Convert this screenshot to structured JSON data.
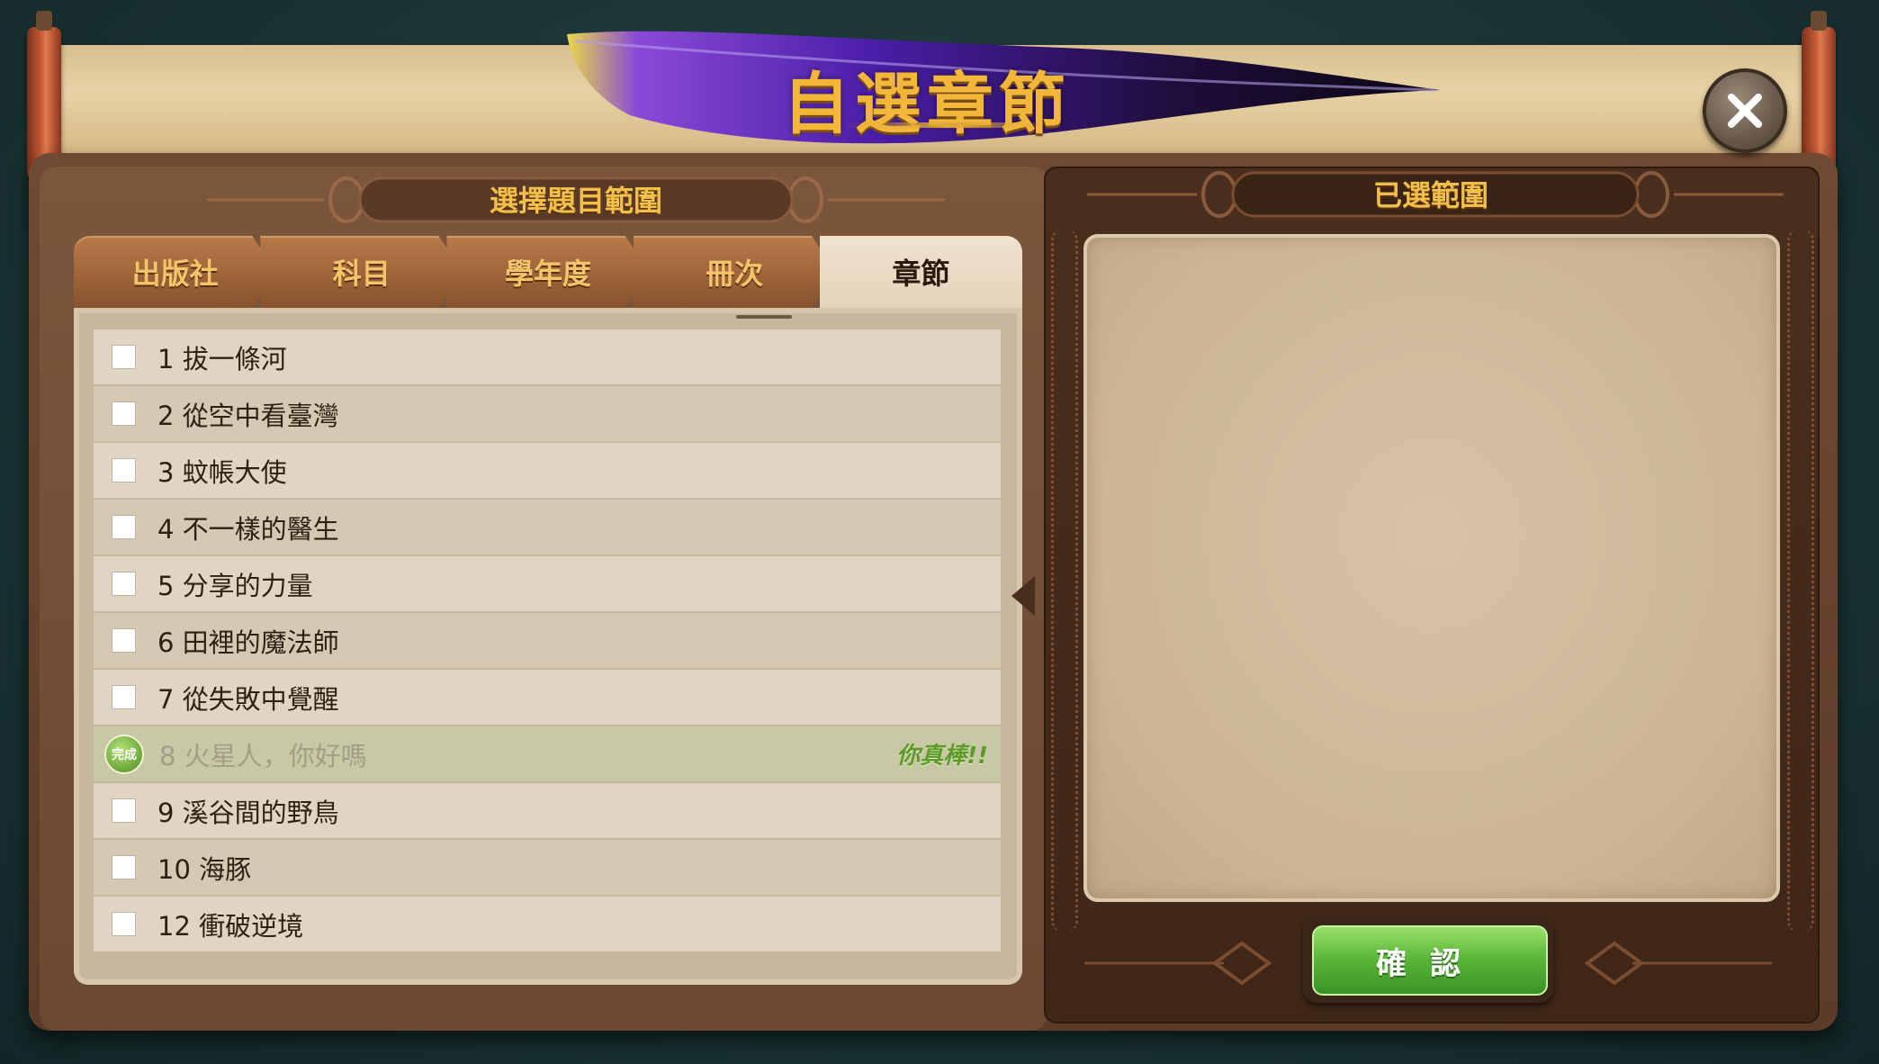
{
  "dialog": {
    "title": "自選章節",
    "close_icon": "close-icon"
  },
  "left_panel": {
    "header": "選擇題目範圍",
    "tabs": [
      {
        "label": "出版社",
        "active": false
      },
      {
        "label": "科目",
        "active": false
      },
      {
        "label": "學年度",
        "active": false
      },
      {
        "label": "冊次",
        "active": false
      },
      {
        "label": "章節",
        "active": true
      }
    ],
    "chapters": [
      {
        "label": "1 拔一條河",
        "completed": false
      },
      {
        "label": "2 從空中看臺灣",
        "completed": false
      },
      {
        "label": "3 蚊帳大使",
        "completed": false
      },
      {
        "label": "4 不一樣的醫生",
        "completed": false
      },
      {
        "label": "5 分享的力量",
        "completed": false
      },
      {
        "label": "6 田裡的魔法師",
        "completed": false
      },
      {
        "label": "7 從失敗中覺醒",
        "completed": false
      },
      {
        "label": "8 火星人，你好嗎",
        "completed": true,
        "badge": "完成",
        "praise": "你真棒!!"
      },
      {
        "label": "9 溪谷間的野鳥",
        "completed": false
      },
      {
        "label": "10 海豚",
        "completed": false
      },
      {
        "label": "12 衝破逆境",
        "completed": false
      }
    ]
  },
  "right_panel": {
    "header": "已選範圍",
    "confirm_label": "確認"
  },
  "colors": {
    "title_gold": "#f2b73a",
    "wood_dark": "#4a2e1d",
    "confirm_green": "#5cb83a",
    "quill_purple": "#5a2ac8"
  }
}
